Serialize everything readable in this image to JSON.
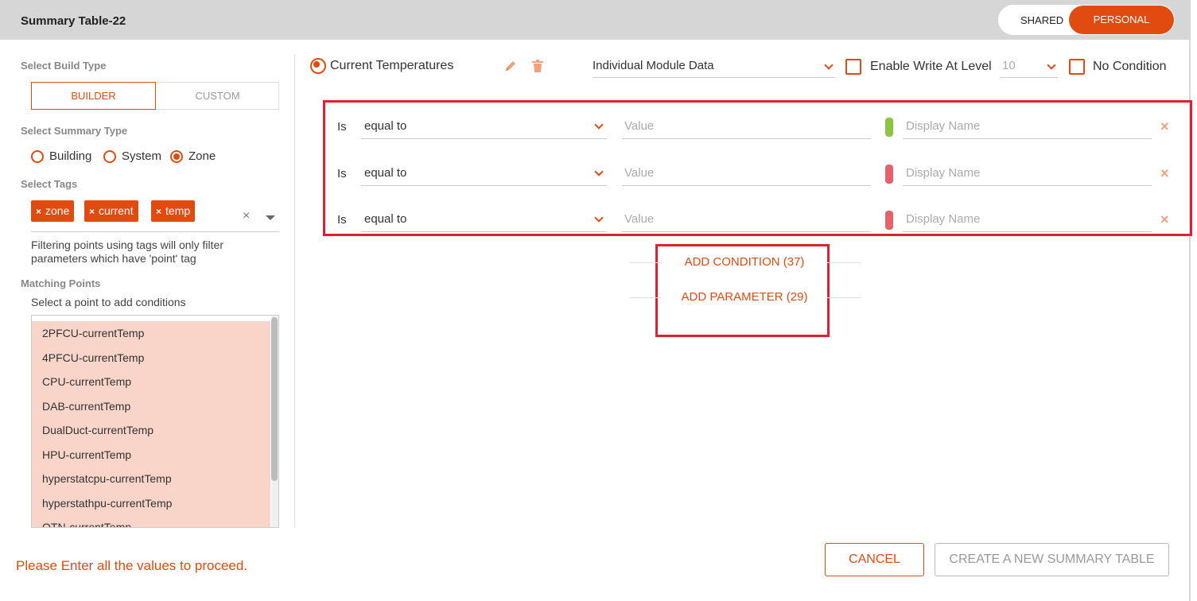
{
  "header": {
    "title": "Summary Table-22",
    "shared_label": "SHARED",
    "personal_label": "PERSONAL",
    "active_tab": "PERSONAL",
    "accent_color": "#e24b0f"
  },
  "left": {
    "build_type_label": "Select Build Type",
    "build_types": [
      "BUILDER",
      "CUSTOM"
    ],
    "selected_build_type": "BUILDER",
    "summary_type_label": "Select Summary Type",
    "summary_types": [
      "Building",
      "System",
      "Zone"
    ],
    "selected_summary_type": "Zone",
    "tags_label": "Select Tags",
    "tags": [
      "zone",
      "current",
      "temp"
    ],
    "tags_clear": "×",
    "filter_note": "Filtering points using tags will only filter parameters which have 'point' tag",
    "matching_label": "Matching Points",
    "matching_hint": "Select a point to add conditions",
    "points": [
      "2PFCU-currentTemp",
      "4PFCU-currentTemp",
      "CPU-currentTemp",
      "DAB-currentTemp",
      "DualDuct-currentTemp",
      "HPU-currentTemp",
      "hyperstatcpu-currentTemp",
      "hyperstathpu-currentTemp",
      "OTN-currentTemp"
    ],
    "error_message": "Please Enter all the values to proceed."
  },
  "param": {
    "name": "Current Temperatures",
    "data_select": "Individual Module Data",
    "enable_write_label": "Enable Write At Level",
    "level_value": "10",
    "no_condition_label": "No Condition"
  },
  "conditions": [
    {
      "is_label": "Is",
      "operator": "equal to",
      "value_placeholder": "Value",
      "display_placeholder": "Display Name",
      "color": "#8cc63f",
      "remove": "×"
    },
    {
      "is_label": "Is",
      "operator": "equal to",
      "value_placeholder": "Value",
      "display_placeholder": "Display Name",
      "color": "#e8606a",
      "remove": "×"
    },
    {
      "is_label": "Is",
      "operator": "equal to",
      "value_placeholder": "Value",
      "display_placeholder": "Display Name",
      "color": "#e8606a",
      "remove": "×"
    }
  ],
  "actions": {
    "add_condition": "ADD CONDITION (37)",
    "add_parameter": "ADD PARAMETER (29)"
  },
  "footer": {
    "cancel_label": "CANCEL",
    "create_label": "CREATE A NEW SUMMARY TABLE"
  },
  "icons": {
    "pencil": "pencil-icon",
    "trash": "trash-icon",
    "chevron": "chevron-down-icon",
    "close": "close-icon"
  }
}
